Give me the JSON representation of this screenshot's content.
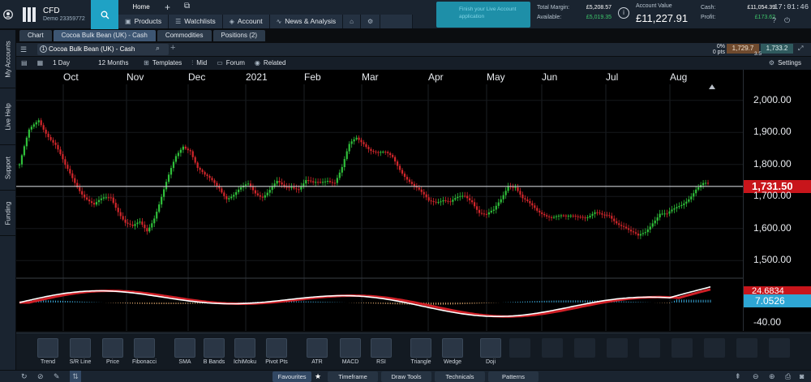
{
  "top": {
    "account_type": "CFD",
    "account_sub": "Demo 23359772",
    "home_label": "Home",
    "tabs": [
      {
        "label": "Products",
        "icon": "briefcase-icon"
      },
      {
        "label": "Watchlists",
        "icon": "list-icon"
      },
      {
        "label": "Account",
        "icon": "tag-icon"
      },
      {
        "label": "News & Analysis",
        "icon": "pulse-icon"
      }
    ],
    "promo_text": "Finish your Live Account application",
    "total_margin_label": "Total Margin:",
    "total_margin_value": "£5,208.57",
    "available_label": "Available:",
    "available_value": "£5,019.35",
    "account_value_label": "Account Value",
    "account_value": "£11,227.91",
    "cash_label": "Cash:",
    "cash_value": "£11,054.39",
    "profit_label": "Profit:",
    "profit_value": "£173.62",
    "clock": "17:01:46"
  },
  "sidebar": {
    "items": [
      "My Accounts",
      "Live Help",
      "Support",
      "Funding"
    ]
  },
  "workspace_tabs": [
    {
      "label": "Chart",
      "active": false
    },
    {
      "label": "Cocoa Bulk Bean (UK) - Cash",
      "active": true
    },
    {
      "label": "Commodities",
      "active": false
    },
    {
      "label": "Positions (2)",
      "active": false
    }
  ],
  "chart_header": {
    "instrument": "Cocoa Bulk Bean (UK) - Cash",
    "instrument_badge": "1",
    "pct_change": "0%",
    "pts_change": "0 pts",
    "sell": "1,729.7",
    "buy": "1,733.2",
    "spread": "3.5"
  },
  "toolbar": {
    "interval": "1 Day",
    "range": "12 Months",
    "templates": "Templates",
    "price_type": "Mid",
    "forum": "Forum",
    "related": "Related",
    "settings": "Settings"
  },
  "chart_data": {
    "type": "candlestick",
    "x_labels": [
      "Oct",
      "Nov",
      "Dec",
      "2021",
      "Feb",
      "Mar",
      "Apr",
      "May",
      "Jun",
      "Jul",
      "Aug"
    ],
    "y_ticks": [
      "2,000.00",
      "1,900.00",
      "1,800.00",
      "1,700.00",
      "1,600.00",
      "1,500.00"
    ],
    "ylim": [
      1450,
      2050
    ],
    "last_price": "1,731.50",
    "close_path": [
      [
        0,
        1800
      ],
      [
        4,
        1900
      ],
      [
        8,
        1940
      ],
      [
        11,
        1905
      ],
      [
        15,
        1860
      ],
      [
        19,
        1790
      ],
      [
        23,
        1745
      ],
      [
        27,
        1705
      ],
      [
        31,
        1670
      ],
      [
        35,
        1690
      ],
      [
        38,
        1700
      ],
      [
        41,
        1660
      ],
      [
        44,
        1620
      ],
      [
        47,
        1600
      ],
      [
        50,
        1615
      ],
      [
        53,
        1595
      ],
      [
        56,
        1640
      ],
      [
        59,
        1700
      ],
      [
        62,
        1760
      ],
      [
        65,
        1820
      ],
      [
        68,
        1860
      ],
      [
        71,
        1850
      ],
      [
        74,
        1790
      ],
      [
        77,
        1760
      ],
      [
        80,
        1745
      ],
      [
        83,
        1730
      ],
      [
        86,
        1700
      ],
      [
        89,
        1705
      ],
      [
        92,
        1720
      ],
      [
        95,
        1735
      ],
      [
        98,
        1715
      ],
      [
        101,
        1705
      ],
      [
        104,
        1720
      ],
      [
        107,
        1740
      ],
      [
        110,
        1725
      ],
      [
        113,
        1735
      ],
      [
        116,
        1730
      ],
      [
        119,
        1750
      ],
      [
        122,
        1735
      ],
      [
        125,
        1740
      ],
      [
        128,
        1755
      ],
      [
        131,
        1750
      ],
      [
        134,
        1790
      ],
      [
        137,
        1855
      ],
      [
        140,
        1880
      ],
      [
        143,
        1870
      ],
      [
        146,
        1850
      ],
      [
        149,
        1835
      ],
      [
        152,
        1830
      ],
      [
        155,
        1820
      ],
      [
        158,
        1790
      ],
      [
        161,
        1760
      ],
      [
        164,
        1730
      ],
      [
        167,
        1705
      ],
      [
        170,
        1685
      ],
      [
        173,
        1690
      ],
      [
        176,
        1695
      ],
      [
        179,
        1680
      ],
      [
        182,
        1690
      ],
      [
        185,
        1700
      ],
      [
        188,
        1690
      ],
      [
        191,
        1655
      ],
      [
        194,
        1640
      ],
      [
        197,
        1650
      ],
      [
        200,
        1690
      ],
      [
        203,
        1740
      ],
      [
        206,
        1735
      ],
      [
        209,
        1690
      ],
      [
        212,
        1670
      ],
      [
        215,
        1655
      ],
      [
        218,
        1650
      ],
      [
        221,
        1640
      ],
      [
        224,
        1635
      ],
      [
        227,
        1630
      ],
      [
        230,
        1640
      ],
      [
        233,
        1645
      ],
      [
        236,
        1640
      ],
      [
        239,
        1645
      ],
      [
        242,
        1635
      ],
      [
        245,
        1640
      ],
      [
        248,
        1625
      ],
      [
        251,
        1610
      ],
      [
        254,
        1585
      ],
      [
        257,
        1570
      ],
      [
        260,
        1590
      ],
      [
        263,
        1625
      ],
      [
        266,
        1650
      ],
      [
        269,
        1640
      ],
      [
        272,
        1655
      ],
      [
        275,
        1675
      ],
      [
        278,
        1700
      ],
      [
        281,
        1725
      ],
      [
        284,
        1735
      ],
      [
        287,
        1731.5
      ]
    ],
    "oscillator": {
      "ylim": [
        -40,
        30
      ],
      "min_label": "-40.00",
      "red_label": "24.6834",
      "blue_label": "7.0526"
    }
  },
  "indicators": [
    {
      "label": "Trend",
      "icon": "trend-icon"
    },
    {
      "label": "S/R Line",
      "icon": "sr-line-icon"
    },
    {
      "label": "Price",
      "icon": "price-icon"
    },
    {
      "label": "Fibonacci",
      "icon": "fibonacci-icon"
    },
    {
      "label": "SMA",
      "icon": "sma-icon"
    },
    {
      "label": "B Bands",
      "icon": "bbands-icon"
    },
    {
      "label": "IchiMoku",
      "icon": "ichimoku-icon"
    },
    {
      "label": "Pivot Pts",
      "icon": "pivot-icon"
    },
    {
      "label": "ATR",
      "icon": "atr-icon"
    },
    {
      "label": "MACD",
      "icon": "macd-icon"
    },
    {
      "label": "RSI",
      "icon": "rsi-icon"
    },
    {
      "label": "Triangle",
      "icon": "triangle-icon"
    },
    {
      "label": "Wedge",
      "icon": "wedge-icon"
    },
    {
      "label": "Doji",
      "icon": "doji-icon"
    }
  ],
  "bottom_tabs": [
    {
      "label": "Favourites",
      "active": true
    },
    {
      "label": "Timeframe",
      "active": false
    },
    {
      "label": "Draw Tools",
      "active": false
    },
    {
      "label": "Technicals",
      "active": false
    },
    {
      "label": "Patterns",
      "active": false
    }
  ]
}
